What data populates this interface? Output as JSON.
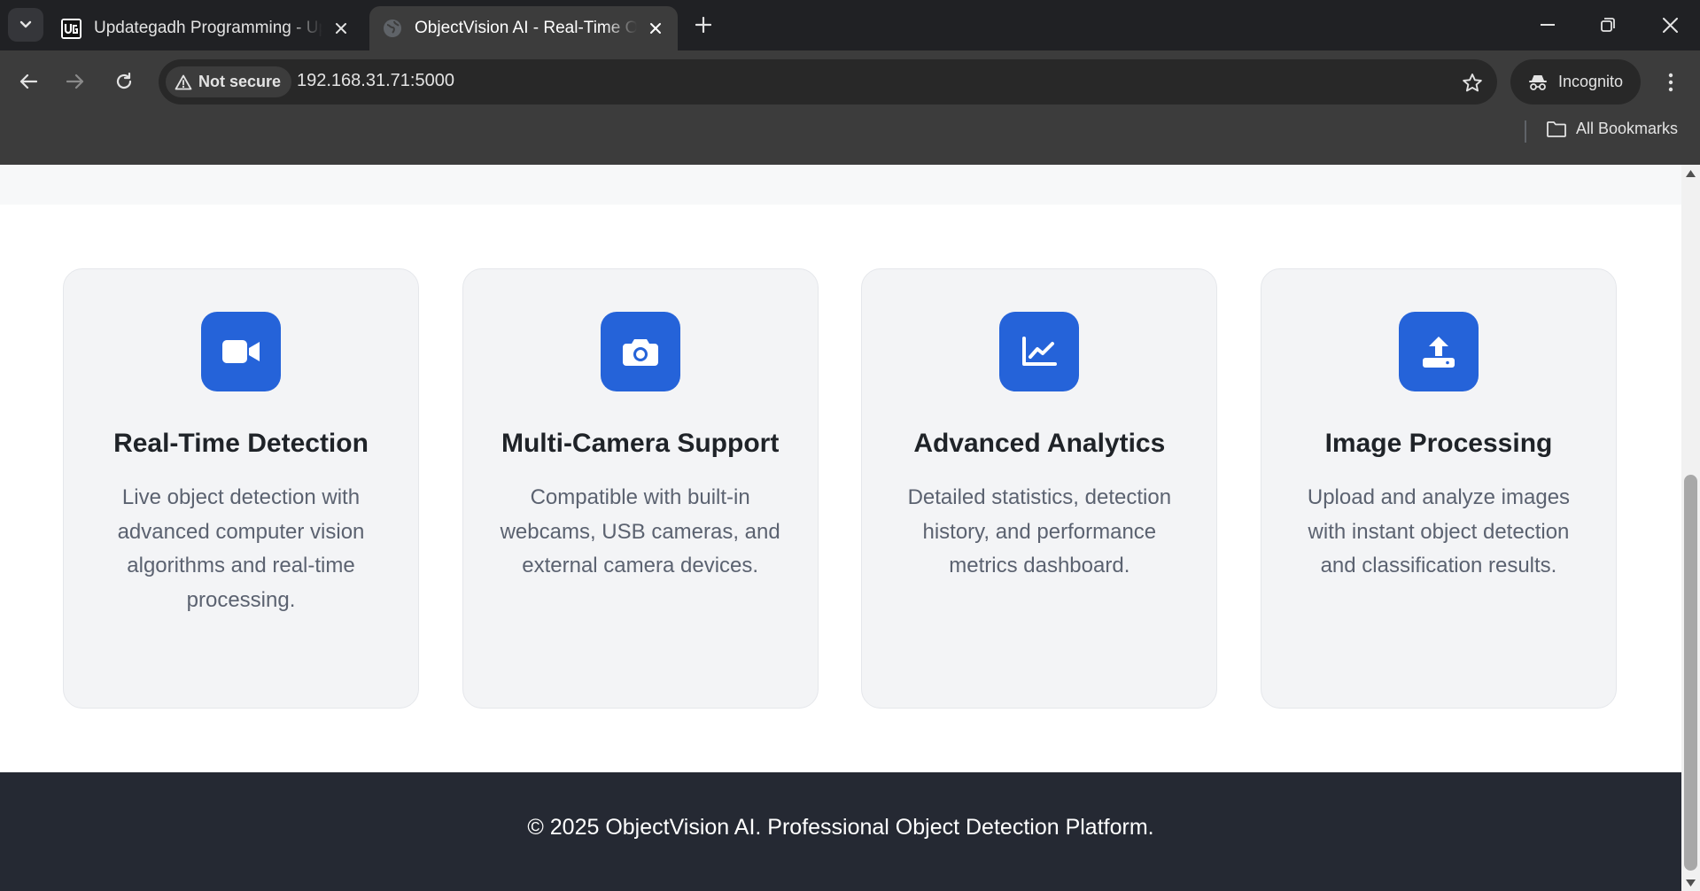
{
  "browser": {
    "tabs": [
      {
        "title": "Updategadh Programming - Up",
        "favicon": "updategadh-logo",
        "active": false
      },
      {
        "title": "ObjectVision AI - Real-Time Obj",
        "favicon": "globe-icon",
        "active": true
      }
    ],
    "security_label": "Not secure",
    "url": "192.168.31.71:5000",
    "incognito_label": "Incognito",
    "bookmarks_label": "All Bookmarks",
    "icons": [
      "chevron-down-icon",
      "close-icon",
      "plus-icon",
      "minimize-icon",
      "restore-icon",
      "back-arrow-icon",
      "forward-arrow-icon",
      "reload-icon",
      "warning-icon",
      "star-icon",
      "incognito-icon",
      "more-vert-icon",
      "folder-icon"
    ]
  },
  "features": [
    {
      "icon": "video-camera-icon",
      "title": "Real-Time Detection",
      "description": "Live object detection with advanced computer vision algorithms and real-time processing."
    },
    {
      "icon": "camera-icon",
      "title": "Multi-Camera Support",
      "description": "Compatible with built-in webcams, USB cameras, and external camera devices."
    },
    {
      "icon": "chart-line-icon",
      "title": "Advanced Analytics",
      "description": "Detailed statistics, detection history, and performance metrics dashboard."
    },
    {
      "icon": "upload-icon",
      "title": "Image Processing",
      "description": "Upload and analyze images with instant object detection and classification results."
    }
  ],
  "footer": {
    "text": "© 2025 ObjectVision AI. Professional Object Detection Platform."
  },
  "colors": {
    "accent": "#2563d9",
    "footer_bg": "#252933",
    "card_bg": "#f3f4f6"
  }
}
